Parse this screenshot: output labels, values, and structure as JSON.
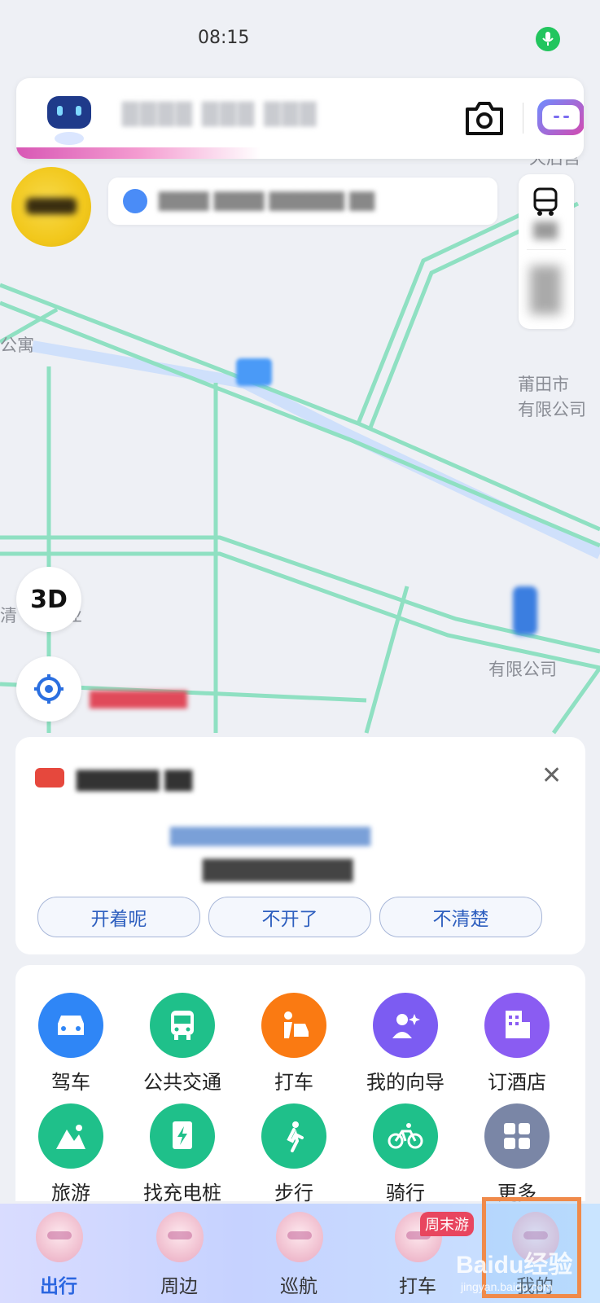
{
  "status_bar": {
    "time": "08:15"
  },
  "map": {
    "labels": {
      "apartment": "公寓",
      "putian": "莆田市",
      "company": "有限公司",
      "qingjiang": "清",
      "industry": "业",
      "tianhou": "天后宫",
      "company2": "有限公司"
    }
  },
  "map_controls": {
    "btn_3d": "3D"
  },
  "survey": {
    "options": [
      "开着呢",
      "不开了",
      "不清楚"
    ]
  },
  "features": [
    {
      "label": "驾车",
      "icon": "car-icon",
      "color": "#2f86f6"
    },
    {
      "label": "公共交通",
      "icon": "bus-icon",
      "color": "#1fc08a"
    },
    {
      "label": "打车",
      "icon": "taxi-icon",
      "color": "#fa7a12"
    },
    {
      "label": "我的向导",
      "icon": "guide-icon",
      "color": "#7c5cf2"
    },
    {
      "label": "订酒店",
      "icon": "hotel-icon",
      "color": "#8a5cf2"
    },
    {
      "label": "旅游",
      "icon": "mountain-icon",
      "color": "#1fc08a"
    },
    {
      "label": "找充电桩",
      "icon": "charging-icon",
      "color": "#1fc08a"
    },
    {
      "label": "步行",
      "icon": "walk-icon",
      "color": "#1fc08a"
    },
    {
      "label": "骑行",
      "icon": "bike-icon",
      "color": "#1fc08a"
    },
    {
      "label": "更多",
      "icon": "more-icon",
      "color": "#7a86a6"
    }
  ],
  "tabbar": {
    "tabs": [
      {
        "label": "出行",
        "active": true
      },
      {
        "label": "周边"
      },
      {
        "label": "巡航"
      },
      {
        "label": "打车",
        "badge": "周末游"
      },
      {
        "label": "我的"
      }
    ]
  },
  "watermark": {
    "text": "Baidu经验",
    "url": "jingyan.baidu.com"
  }
}
